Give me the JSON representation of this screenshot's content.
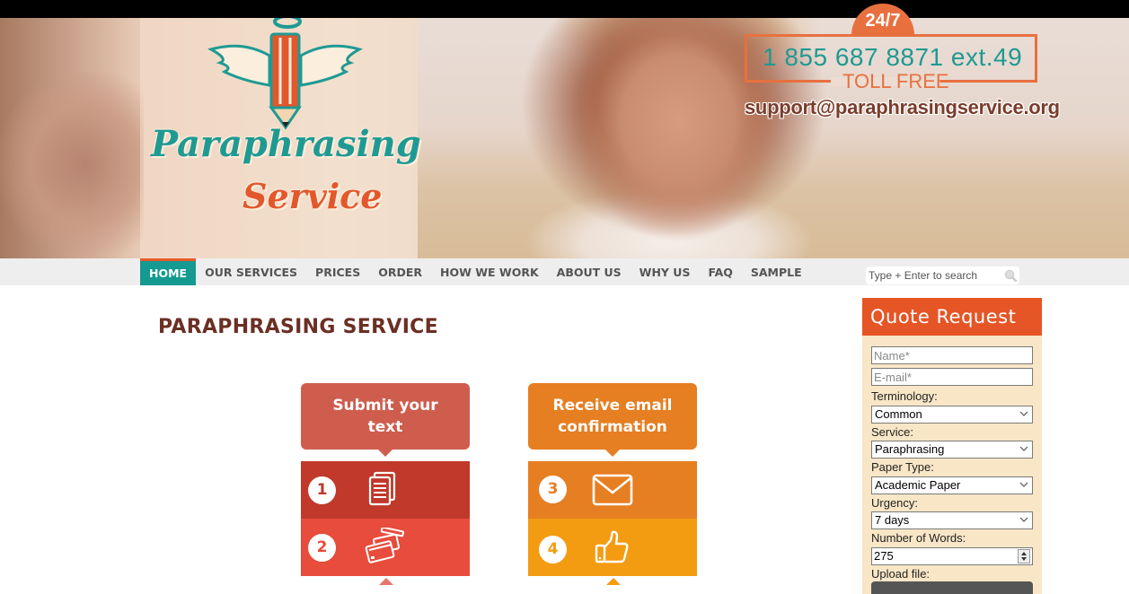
{
  "brand": {
    "logo_line1": "Paraphrasing",
    "logo_line2": "Service",
    "colors": {
      "teal": "#159a92",
      "orange": "#e65526",
      "maroon": "#6b2f24"
    }
  },
  "contact": {
    "badge": "24/7",
    "phone": "1 855 687 8871 ext.49",
    "toll_free": "TOLL FREE",
    "email": "support@paraphrasingservice.org"
  },
  "nav": {
    "items": [
      {
        "label": "HOME",
        "active": true
      },
      {
        "label": "OUR SERVICES"
      },
      {
        "label": "PRICES"
      },
      {
        "label": "ORDER"
      },
      {
        "label": "HOW WE WORK"
      },
      {
        "label": "ABOUT US"
      },
      {
        "label": "WHY US"
      },
      {
        "label": "FAQ"
      },
      {
        "label": "SAMPLE"
      }
    ],
    "search_placeholder": "Type + Enter to search",
    "search_icon": "magnifier-icon"
  },
  "main": {
    "title": "PARAPHRASING SERVICE",
    "steps": [
      {
        "heading": "Submit your text",
        "rows": [
          {
            "number": "1",
            "icon": "documents-icon"
          },
          {
            "number": "2",
            "icon": "credit-cards-icon"
          }
        ]
      },
      {
        "heading": "Receive email confirmation",
        "rows": [
          {
            "number": "3",
            "icon": "envelope-icon"
          },
          {
            "number": "4",
            "icon": "thumbs-up-icon"
          }
        ]
      }
    ]
  },
  "quote": {
    "title": "Quote Request",
    "name_placeholder": "Name*",
    "email_placeholder": "E-mail*",
    "terminology_label": "Terminology:",
    "terminology_value": "Common",
    "service_label": "Service:",
    "service_value": "Paraphrasing",
    "paper_type_label": "Paper Type:",
    "paper_type_value": "Academic Paper",
    "urgency_label": "Urgency:",
    "urgency_value": "7 days",
    "words_label": "Number of Words:",
    "words_value": "275",
    "upload_label": "Upload file:"
  }
}
